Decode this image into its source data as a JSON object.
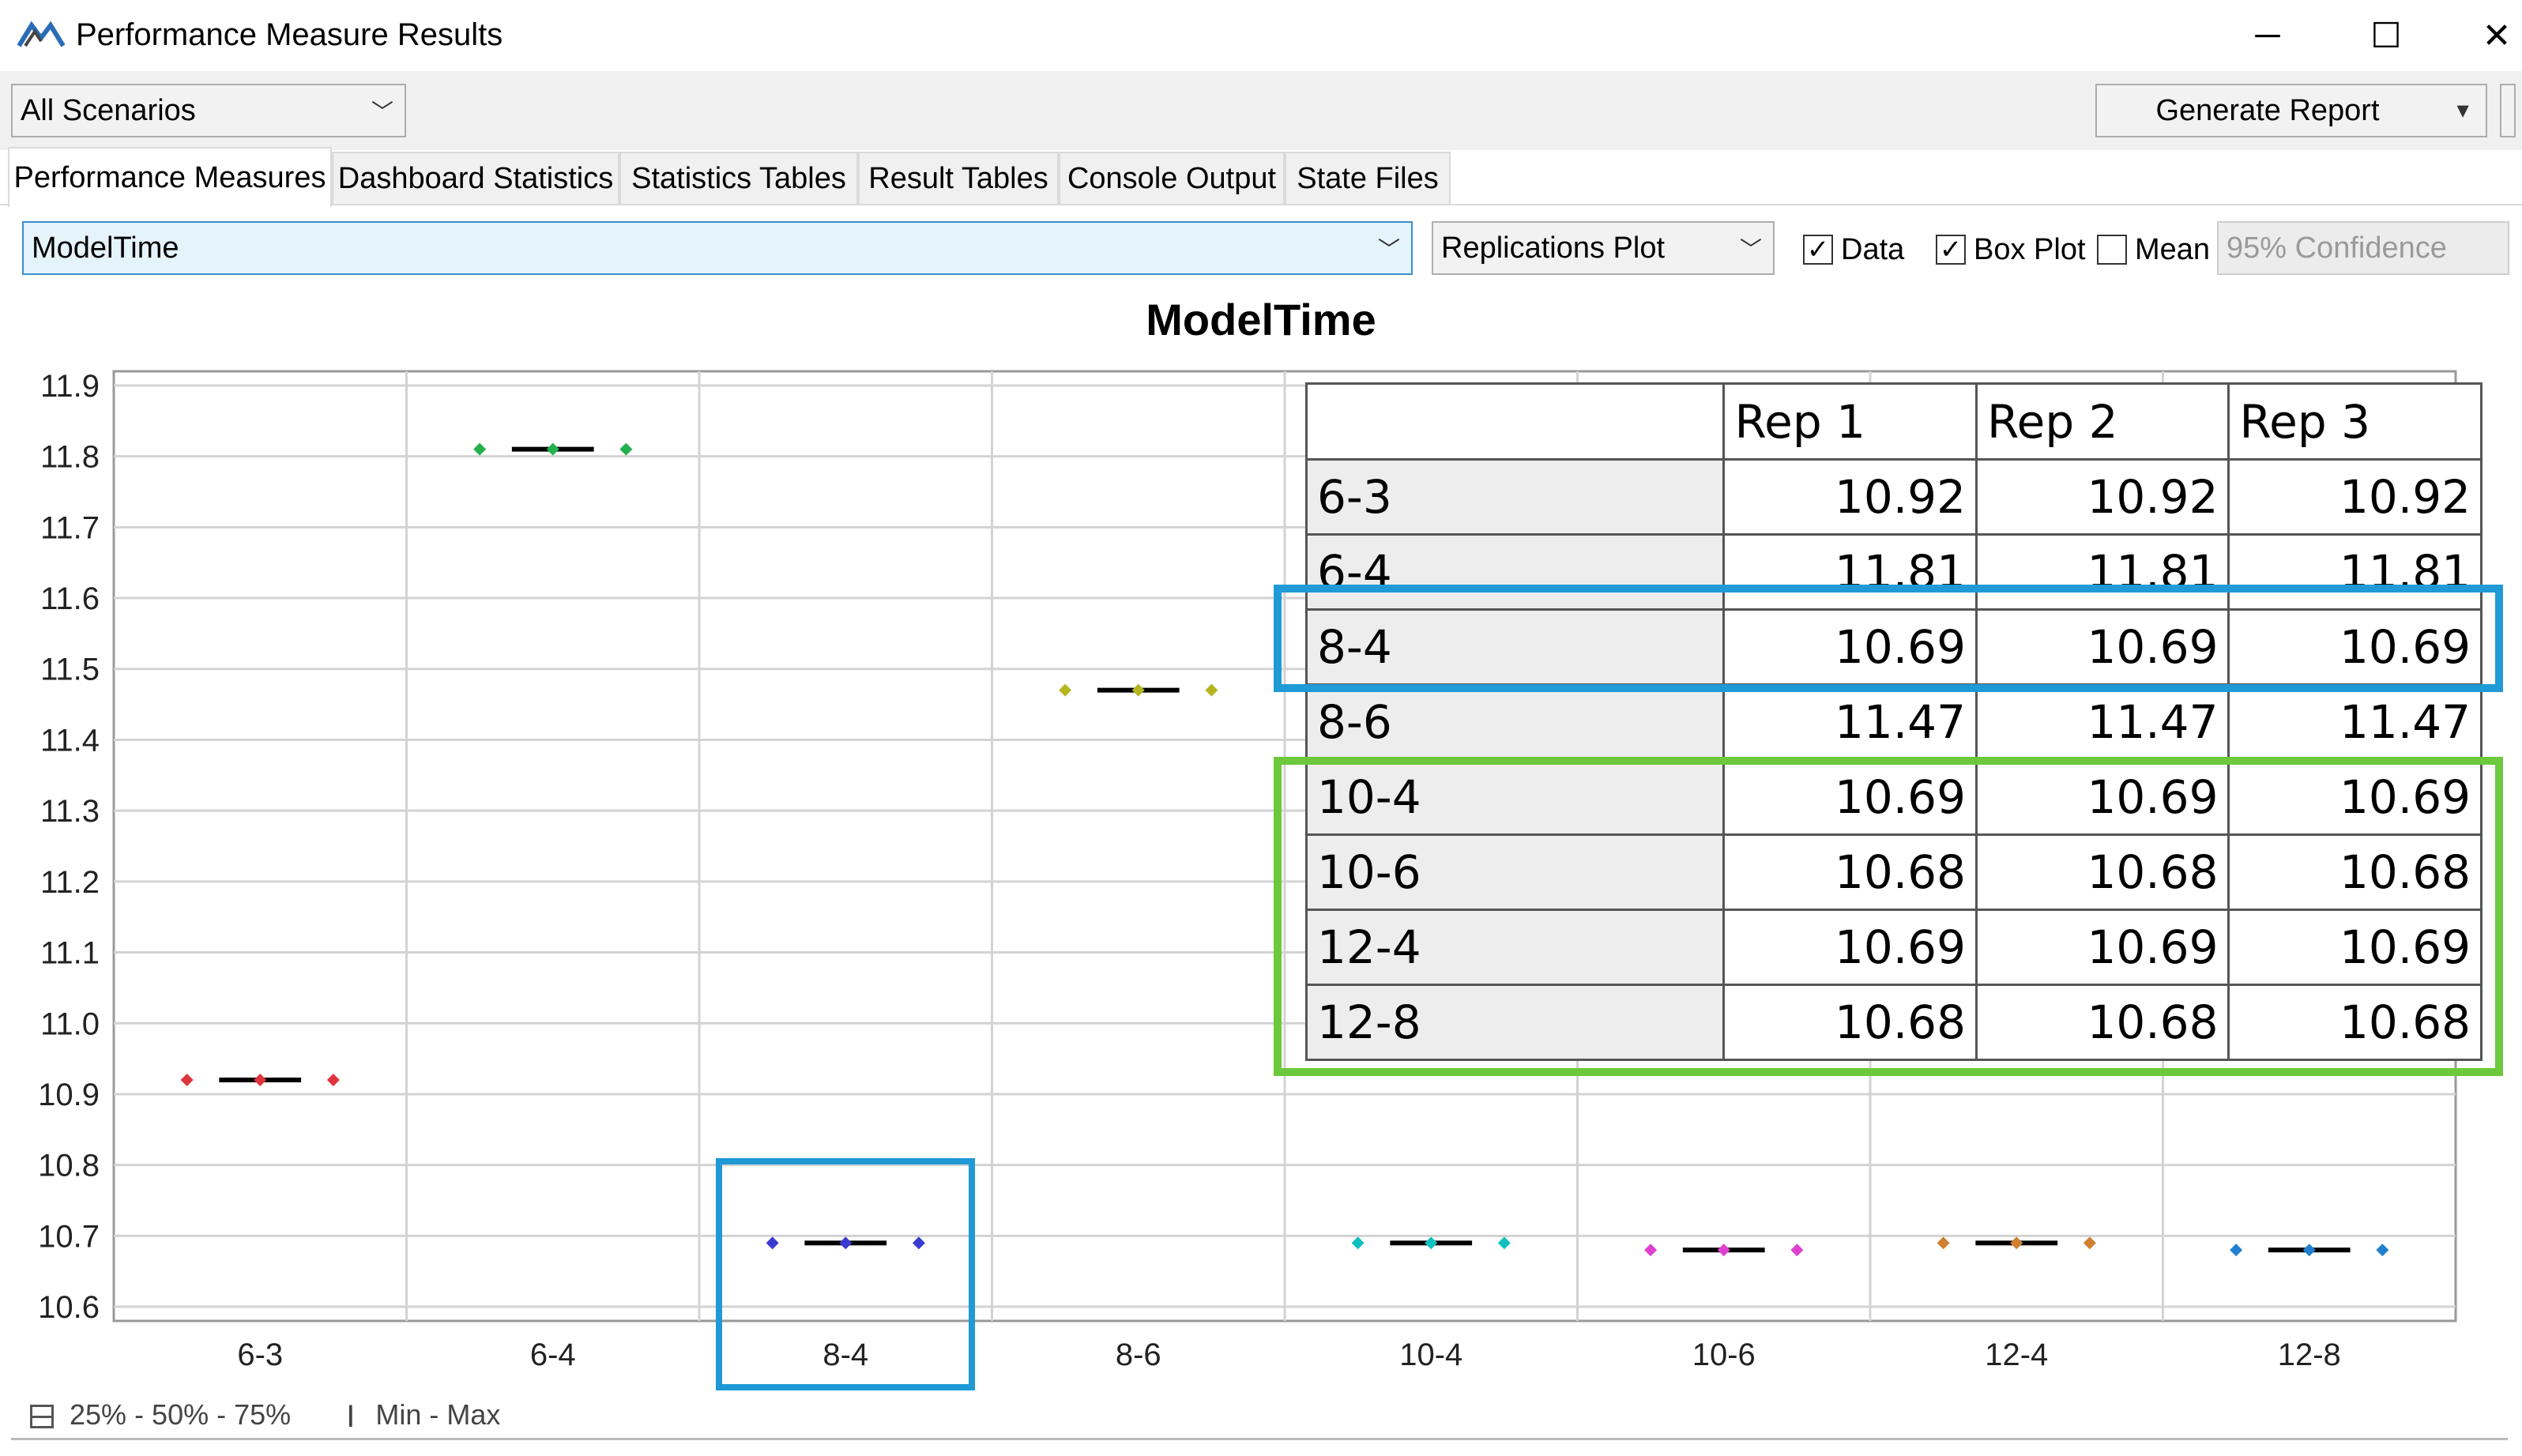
{
  "window": {
    "title": "Performance Measure Results",
    "app_icon": "flexsim-logo-icon",
    "controls": {
      "minimize": "─",
      "maximize": "☐",
      "close": "✕"
    }
  },
  "toolbar": {
    "scenario_select": "All Scenarios",
    "generate_report_label": "Generate Report"
  },
  "tabs": [
    {
      "label": "Performance Measures",
      "active": true
    },
    {
      "label": "Dashboard Statistics",
      "active": false
    },
    {
      "label": "Statistics Tables",
      "active": false
    },
    {
      "label": "Result Tables",
      "active": false
    },
    {
      "label": "Console Output",
      "active": false
    },
    {
      "label": "State Files",
      "active": false
    }
  ],
  "options": {
    "measure_select": "ModelTime",
    "plot_type_select": "Replications Plot",
    "checkboxes": [
      {
        "label": "Data",
        "checked": true
      },
      {
        "label": "Box Plot",
        "checked": true
      },
      {
        "label": "Mean",
        "checked": false
      }
    ],
    "confidence_select": "95% Confidence"
  },
  "chart_data": {
    "type": "scatter",
    "title": "ModelTime",
    "categories": [
      "6-3",
      "6-4",
      "8-4",
      "8-6",
      "10-4",
      "10-6",
      "12-4",
      "12-8"
    ],
    "y_ticks": [
      "11.9",
      "11.8",
      "11.7",
      "11.6",
      "11.5",
      "11.4",
      "11.3",
      "11.2",
      "11.1",
      "11.0",
      "10.9",
      "10.8",
      "10.7",
      "10.6"
    ],
    "ylim": [
      10.58,
      11.92
    ],
    "grid": true,
    "series": [
      {
        "category": "6-3",
        "values": [
          10.92,
          10.92,
          10.92
        ],
        "color": "#e0343c"
      },
      {
        "category": "6-4",
        "values": [
          11.81,
          11.81,
          11.81
        ],
        "color": "#22b14c"
      },
      {
        "category": "8-4",
        "values": [
          10.69,
          10.69,
          10.69
        ],
        "color": "#3a3ad0"
      },
      {
        "category": "8-6",
        "values": [
          11.47,
          11.47,
          11.47
        ],
        "color": "#b5b520"
      },
      {
        "category": "10-4",
        "values": [
          10.69,
          10.69,
          10.69
        ],
        "color": "#10c0c0"
      },
      {
        "category": "10-6",
        "values": [
          10.68,
          10.68,
          10.68
        ],
        "color": "#e040d0"
      },
      {
        "category": "12-4",
        "values": [
          10.69,
          10.69,
          10.69
        ],
        "color": "#d08030"
      },
      {
        "category": "12-8",
        "values": [
          10.68,
          10.68,
          10.68
        ],
        "color": "#2080d0"
      }
    ],
    "legend": [
      {
        "icon": "box-plot-icon",
        "label": "25% - 50% - 75%"
      },
      {
        "icon": "min-max-icon",
        "label": "Min - Max"
      }
    ]
  },
  "results_table": {
    "columns": [
      "",
      "Rep 1",
      "Rep 2",
      "Rep 3"
    ],
    "rows": [
      {
        "name": "6-3",
        "values": [
          "10.92",
          "10.92",
          "10.92"
        ]
      },
      {
        "name": "6-4",
        "values": [
          "11.81",
          "11.81",
          "11.81"
        ]
      },
      {
        "name": "8-4",
        "values": [
          "10.69",
          "10.69",
          "10.69"
        ]
      },
      {
        "name": "8-6",
        "values": [
          "11.47",
          "11.47",
          "11.47"
        ]
      },
      {
        "name": "10-4",
        "values": [
          "10.69",
          "10.69",
          "10.69"
        ]
      },
      {
        "name": "10-6",
        "values": [
          "10.68",
          "10.68",
          "10.68"
        ]
      },
      {
        "name": "12-4",
        "values": [
          "10.69",
          "10.69",
          "10.69"
        ]
      },
      {
        "name": "12-8",
        "values": [
          "10.68",
          "10.68",
          "10.68"
        ]
      }
    ]
  },
  "annotations": {
    "blue_color": "#1f9ad6",
    "green_color": "#6cc83c"
  }
}
